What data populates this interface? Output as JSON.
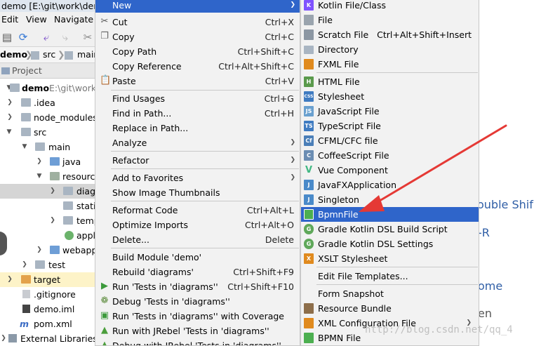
{
  "window": {
    "title": "demo [E:\\git\\work\\demo]"
  },
  "menubar": {
    "items": [
      "Edit",
      "View",
      "Navigate"
    ]
  },
  "breadcrumb": {
    "items": [
      "demo",
      "src",
      "main"
    ]
  },
  "project_panel": {
    "title": "Project",
    "root": {
      "label": "demo",
      "path": "E:\\git\\work"
    },
    "items": [
      ".idea",
      "node_modules",
      "src",
      "main",
      "java",
      "resources",
      "diagrams",
      "static",
      "templates",
      "application",
      "webapp",
      "test",
      "target",
      ".gitignore",
      "demo.iml",
      "pom.xml",
      "External Libraries"
    ],
    "items_shown": [
      ".idea",
      "node_modules",
      "src",
      "main",
      "java",
      "resource",
      "diag",
      "statio",
      "temp",
      "appli",
      "webapp",
      "test",
      "target",
      ".gitignore",
      "demo.iml",
      "pom.xml",
      "External Libraries"
    ]
  },
  "editor": {
    "fragments": [
      "ouble Shif",
      "-R",
      "ome",
      "en"
    ]
  },
  "context_menu": {
    "items": [
      {
        "label": "New",
        "shortcut": "",
        "submenu": true,
        "icon": ""
      },
      {
        "label": "Cut",
        "shortcut": "Ctrl+X",
        "icon": "scissors-icon"
      },
      {
        "label": "Copy",
        "shortcut": "Ctrl+C",
        "icon": "copy-icon"
      },
      {
        "label": "Copy Path",
        "shortcut": "Ctrl+Shift+C",
        "icon": ""
      },
      {
        "label": "Copy Reference",
        "shortcut": "Ctrl+Alt+Shift+C",
        "icon": ""
      },
      {
        "label": "Paste",
        "shortcut": "Ctrl+V",
        "icon": "paste-icon"
      },
      {
        "label": "Find Usages",
        "shortcut": "Ctrl+G",
        "icon": ""
      },
      {
        "label": "Find in Path...",
        "shortcut": "Ctrl+H",
        "icon": ""
      },
      {
        "label": "Replace in Path...",
        "shortcut": "",
        "icon": ""
      },
      {
        "label": "Analyze",
        "shortcut": "",
        "submenu": true,
        "icon": ""
      },
      {
        "label": "Refactor",
        "shortcut": "",
        "submenu": true,
        "icon": ""
      },
      {
        "label": "Add to Favorites",
        "shortcut": "",
        "submenu": true,
        "icon": ""
      },
      {
        "label": "Show Image Thumbnails",
        "shortcut": "",
        "icon": ""
      },
      {
        "label": "Reformat Code",
        "shortcut": "Ctrl+Alt+L",
        "icon": ""
      },
      {
        "label": "Optimize Imports",
        "shortcut": "Ctrl+Alt+O",
        "icon": ""
      },
      {
        "label": "Delete...",
        "shortcut": "Delete",
        "icon": ""
      },
      {
        "label": "Build Module 'demo'",
        "shortcut": "",
        "icon": ""
      },
      {
        "label": "Rebuild 'diagrams'",
        "shortcut": "Ctrl+Shift+F9",
        "icon": ""
      },
      {
        "label": "Run 'Tests in 'diagrams''",
        "shortcut": "Ctrl+Shift+F10",
        "icon": "run-icon"
      },
      {
        "label": "Debug 'Tests in 'diagrams''",
        "shortcut": "",
        "icon": "debug-icon"
      },
      {
        "label": "Run 'Tests in 'diagrams'' with Coverage",
        "shortcut": "",
        "icon": "coverage-icon"
      },
      {
        "label": "Run with JRebel 'Tests in 'diagrams''",
        "shortcut": "",
        "icon": "jrebel-icon"
      },
      {
        "label": "Debug with JRebel 'Tests in 'diagrams''",
        "shortcut": "",
        "icon": "jrebel-debug-icon"
      }
    ]
  },
  "new_submenu": {
    "items": [
      {
        "label": "Kotlin File/Class",
        "shortcut": "",
        "icon": "kotlin-icon",
        "color": "#7f52ff"
      },
      {
        "label": "File",
        "shortcut": "",
        "icon": "file-icon",
        "color": "#9aa4ae"
      },
      {
        "label": "Scratch File",
        "shortcut": "Ctrl+Alt+Shift+Insert",
        "icon": "scratch-file-icon",
        "color": "#8c97a3"
      },
      {
        "label": "Directory",
        "shortcut": "",
        "icon": "folder-icon",
        "color": "#a9b5c2"
      },
      {
        "label": "FXML File",
        "shortcut": "",
        "icon": "fxml-icon",
        "color": "#e08a1e"
      },
      {
        "label": "HTML File",
        "shortcut": "",
        "icon": "html-icon",
        "color": "#5a9a4c"
      },
      {
        "label": "Stylesheet",
        "shortcut": "",
        "icon": "css-icon",
        "color": "#3f7bc1"
      },
      {
        "label": "JavaScript File",
        "shortcut": "",
        "icon": "javascript-icon",
        "color": "#6aa0cf"
      },
      {
        "label": "TypeScript File",
        "shortcut": "",
        "icon": "typescript-icon",
        "color": "#3f7bc1"
      },
      {
        "label": "CFML/CFC file",
        "shortcut": "",
        "icon": "cfml-icon",
        "color": "#4b7fb8"
      },
      {
        "label": "CoffeeScript File",
        "shortcut": "",
        "icon": "coffeescript-icon",
        "color": "#6b8db3"
      },
      {
        "label": "Vue Component",
        "shortcut": "",
        "icon": "vue-icon",
        "color": "#42b883"
      },
      {
        "label": "JavaFXApplication",
        "shortcut": "",
        "icon": "javafx-icon",
        "color": "#4a8ac9"
      },
      {
        "label": "Singleton",
        "shortcut": "",
        "icon": "singleton-icon",
        "color": "#4a8ac9"
      },
      {
        "label": "BpmnFile",
        "shortcut": "",
        "icon": "bpmn-icon",
        "color": "#4caf50"
      },
      {
        "label": "Gradle Kotlin DSL Build Script",
        "shortcut": "",
        "icon": "gradle-icon",
        "color": "#5fa85a"
      },
      {
        "label": "Gradle Kotlin DSL Settings",
        "shortcut": "",
        "icon": "gradle-settings-icon",
        "color": "#5fa85a"
      },
      {
        "label": "XSLT Stylesheet",
        "shortcut": "",
        "icon": "xslt-icon",
        "color": "#e08a1e"
      },
      {
        "label": "Edit File Templates...",
        "shortcut": "",
        "icon": "",
        "color": ""
      },
      {
        "label": "Form Snapshot",
        "shortcut": "",
        "icon": "",
        "color": ""
      },
      {
        "label": "Resource Bundle",
        "shortcut": "",
        "icon": "resource-bundle-icon",
        "color": "#8d6e4a"
      },
      {
        "label": "XML Configuration File",
        "shortcut": "",
        "submenu": true,
        "icon": "xml-config-icon",
        "color": "#e08a1e"
      },
      {
        "label": "BPMN File",
        "shortcut": "",
        "icon": "bpmn-file-icon",
        "color": "#4caf50"
      }
    ],
    "active_label": "BpmnFile"
  },
  "watermark": "http://blog.csdn.net/qq_4",
  "colors": {
    "highlight": "#2f65ca",
    "arrow": "#e53935",
    "menu_bg": "#f2f2f2"
  }
}
